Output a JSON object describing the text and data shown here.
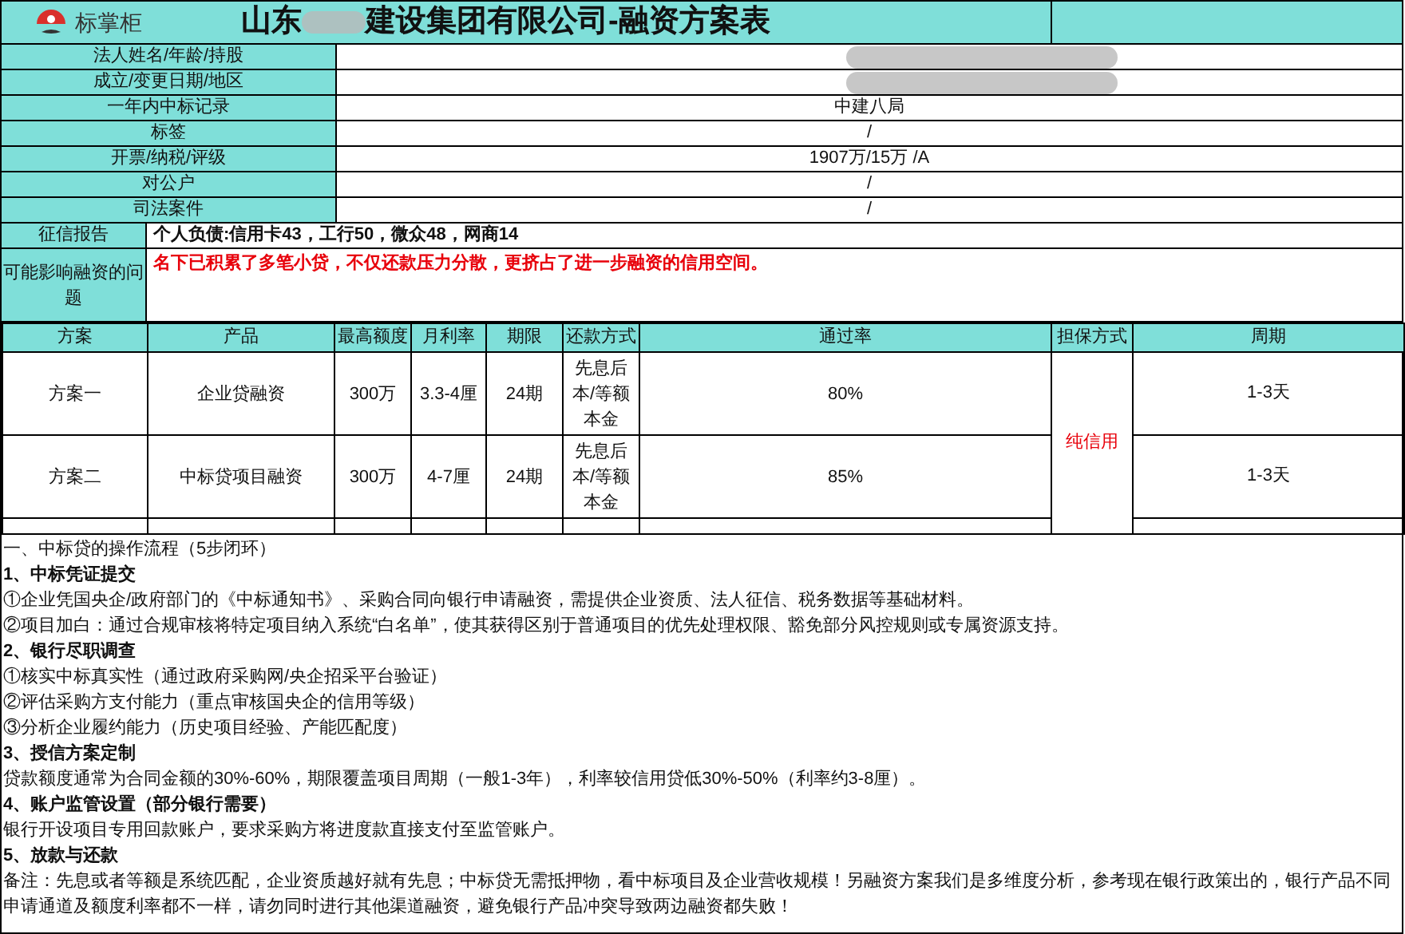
{
  "header": {
    "logo_text": "标掌柜",
    "title_prefix": "山东",
    "title_redacted": true,
    "title_suffix": "建设集团有限公司-融资方案表"
  },
  "info_rows": [
    {
      "label": "法人姓名/年龄/持股",
      "redacted": true
    },
    {
      "label": "成立/变更日期/地区",
      "redacted": true
    },
    {
      "label": "一年内中标记录",
      "redacted": false,
      "value": "中建八局"
    },
    {
      "label": "标签",
      "redacted": false,
      "value": "/"
    },
    {
      "label": "开票/纳税/评级",
      "redacted": false,
      "value": "1907万/15万 /A"
    },
    {
      "label": "对公户",
      "redacted": false,
      "value": "/"
    },
    {
      "label": "司法案件",
      "redacted": false,
      "value": "/"
    }
  ],
  "credit_report": {
    "label": "征信报告",
    "value": "个人负债:信用卡43，工行50，微众48，网商14"
  },
  "issues": {
    "label": "可能影响融资的问题",
    "value": "名下已积累了多笔小贷，不仅还款压力分散，更挤占了进一步融资的信用空间。"
  },
  "plans": {
    "columns": [
      "方案",
      "产品",
      "最高额度",
      "月利率",
      "期限",
      "还款方式",
      "通过率",
      "担保方式",
      "周期"
    ],
    "guarantee": "纯信用",
    "rows": [
      {
        "cells": [
          "方案一",
          "企业贷融资",
          "300万",
          "3.3-4厘",
          "24期",
          "先息后本/等额本金",
          "80%"
        ],
        "cycle": "1-3天"
      },
      {
        "cells": [
          "方案二",
          "中标贷项目融资",
          "300万",
          "4-7厘",
          "24期",
          "先息后本/等额本金",
          "85%"
        ],
        "cycle": "1-3天"
      }
    ]
  },
  "notes": [
    {
      "kind": "text",
      "text": "一、中标贷的操作流程（5步闭环）"
    },
    {
      "kind": "heading",
      "text": "1、中标凭证提交"
    },
    {
      "kind": "text",
      "text": "①企业凭国央企/政府部门的《中标通知书》、采购合同向银行申请融资，需提供企业资质、法人征信、税务数据等基础材料。"
    },
    {
      "kind": "text",
      "text": "②项目加白：通过合规审核将特定项目纳入系统“白名单”，使其获得区别于普通项目的优先处理权限、豁免部分风控规则或专属资源支持。"
    },
    {
      "kind": "heading",
      "text": "2、银行尽职调查"
    },
    {
      "kind": "text",
      "text": "①核实中标真实性（通过政府采购网/央企招采平台验证）"
    },
    {
      "kind": "text",
      "text": "②评估采购方支付能力（重点审核国央企的信用等级）"
    },
    {
      "kind": "text",
      "text": "③分析企业履约能力（历史项目经验、产能匹配度）"
    },
    {
      "kind": "heading",
      "text": "3、授信方案定制"
    },
    {
      "kind": "text",
      "text": "贷款额度通常为合同金额的30%-60%，期限覆盖项目周期（一般1-3年），利率较信用贷低30%-50%（利率约3-8厘）。"
    },
    {
      "kind": "heading",
      "text": "4、账户监管设置（部分银行需要）"
    },
    {
      "kind": "text",
      "text": "银行开设项目专用回款账户，要求采购方将进度款直接支付至监管账户。"
    },
    {
      "kind": "heading",
      "text": "5、放款与还款"
    },
    {
      "kind": "text",
      "text": "备注：先息或者等额是系统匹配，企业资质越好就有先息；中标贷无需抵押物，看中标项目及企业营收规模！另融资方案我们是多维度分析，参考现在银行政策出的，银行产品不同申请通道及额度利率都不一样，请勿同时进行其他渠道融资，避免银行产品冲突导致两边融资都失败！"
    }
  ]
}
